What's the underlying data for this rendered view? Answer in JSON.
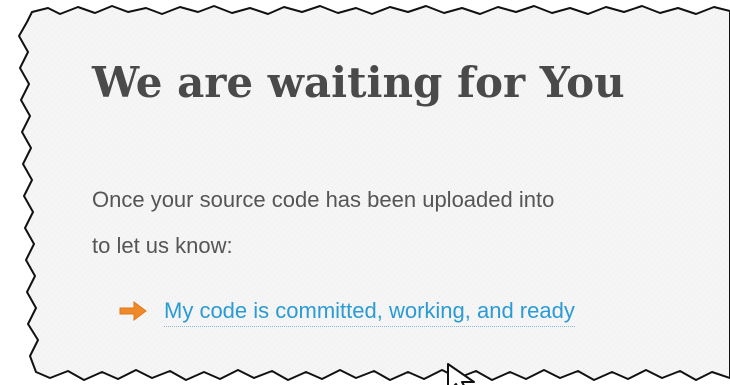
{
  "page": {
    "heading": "We are waiting for You",
    "body_line1": "Once your source code has been uploaded into",
    "body_line2": "to let us know:",
    "link_text": "My code is committed, working, and ready",
    "icons": {
      "bullet": "arrow-right-icon",
      "cursor": "mouse-pointer-icon"
    }
  },
  "colors": {
    "heading": "#4a4a4a",
    "body": "#555555",
    "link": "#2a9bd4",
    "arrow": "#f0892a",
    "paper": "#f5f5f5"
  }
}
